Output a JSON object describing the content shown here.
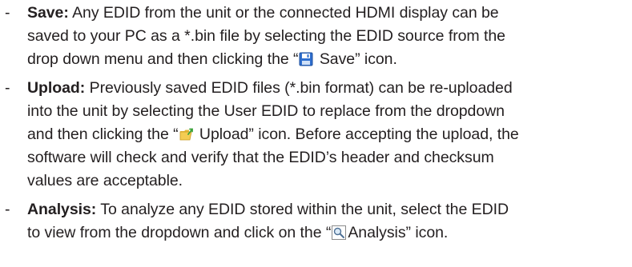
{
  "items": [
    {
      "bullet": "-",
      "term": "Save:",
      "lines": {
        "l1": "Any EDID from the unit or the connected HDMI display can be",
        "l2": "saved to your PC as a *.bin file by selecting the EDID source from the",
        "l3_before": "drop down menu and then clicking the “",
        "l3_after": " Save” icon."
      },
      "icon": "floppy-disk-save-icon"
    },
    {
      "bullet": "-",
      "term": "Upload:",
      "lines": {
        "l1": "Previously saved EDID files (*.bin format) can be re-uploaded",
        "l2": "into the unit by selecting the User EDID to replace from the dropdown",
        "l3_before": "and then clicking the “",
        "l3_after": " Upload” icon. Before accepting the upload, the",
        "l4": "software will check and verify that the EDID’s header and checksum",
        "l5": "values are acceptable."
      },
      "icon": "folder-upload-icon"
    },
    {
      "bullet": "-",
      "term": "Analysis:",
      "lines": {
        "l1": "To analyze any EDID stored within the unit, select the EDID",
        "l2_before": "to view from the dropdown and click on the “",
        "l2_after": "Analysis” icon."
      },
      "icon": "magnifier-analysis-icon"
    }
  ]
}
